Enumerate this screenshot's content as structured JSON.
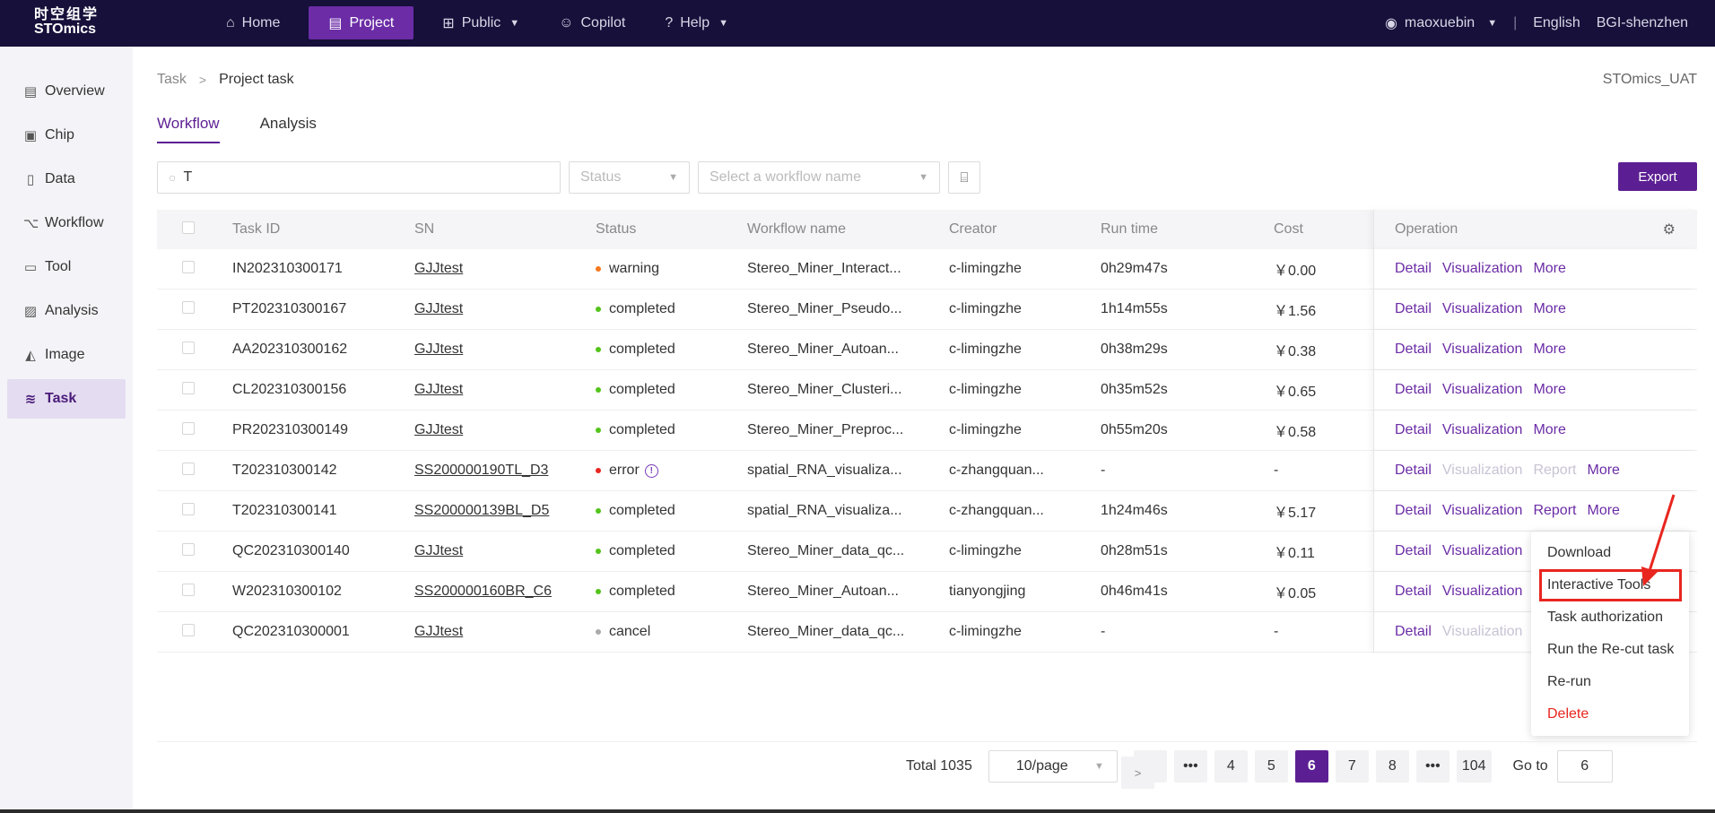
{
  "header": {
    "logo_cn": "时空组学",
    "logo_en": "STOmics",
    "nav": [
      {
        "label": "Home",
        "icon": "home-icon"
      },
      {
        "label": "Project",
        "icon": "document-icon",
        "active": true
      },
      {
        "label": "Public",
        "icon": "grid-icon",
        "dropdown": true
      },
      {
        "label": "Copilot",
        "icon": "copilot-icon"
      },
      {
        "label": "Help",
        "icon": "help-icon",
        "dropdown": true
      }
    ],
    "user": "maoxuebin",
    "separator": "|",
    "language": "English",
    "org": "BGI-shenzhen"
  },
  "sidebar": {
    "items": [
      {
        "label": "Overview",
        "icon": "overview-icon"
      },
      {
        "label": "Chip",
        "icon": "chip-icon"
      },
      {
        "label": "Data",
        "icon": "data-icon"
      },
      {
        "label": "Workflow",
        "icon": "workflow-icon"
      },
      {
        "label": "Tool",
        "icon": "tool-icon"
      },
      {
        "label": "Analysis",
        "icon": "analysis-icon"
      },
      {
        "label": "Image",
        "icon": "image-icon"
      },
      {
        "label": "Task",
        "icon": "layers-icon",
        "active": true
      }
    ]
  },
  "breadcrumb": {
    "parent": "Task",
    "current": "Project task"
  },
  "environment": "STOmics_UAT",
  "tabs": [
    {
      "label": "Workflow",
      "active": true
    },
    {
      "label": "Analysis",
      "active": false
    }
  ],
  "filters": {
    "search_value": "T",
    "status_placeholder": "Status",
    "workflow_placeholder": "Select a workflow name",
    "export_label": "Export"
  },
  "table": {
    "columns": [
      "Task ID",
      "SN",
      "Status",
      "Workflow name",
      "Creator",
      "Run time",
      "Cost",
      "Operation"
    ],
    "rows": [
      {
        "id": "IN202310300171",
        "sn": "GJJtest",
        "status": "warning",
        "status_color": "#f5781f",
        "workflow": "Stereo_Miner_Interact...",
        "creator": "c-limingzhe",
        "run": "0h29m47s",
        "cost": "￥0.00",
        "ops": [
          "Detail",
          "Visualization",
          "More"
        ],
        "disabled": []
      },
      {
        "id": "PT202310300167",
        "sn": "GJJtest",
        "status": "completed",
        "status_color": "#52c41a",
        "workflow": "Stereo_Miner_Pseudo...",
        "creator": "c-limingzhe",
        "run": "1h14m55s",
        "cost": "￥1.56",
        "ops": [
          "Detail",
          "Visualization",
          "More"
        ],
        "disabled": []
      },
      {
        "id": "AA202310300162",
        "sn": "GJJtest",
        "status": "completed",
        "status_color": "#52c41a",
        "workflow": "Stereo_Miner_Autoan...",
        "creator": "c-limingzhe",
        "run": "0h38m29s",
        "cost": "￥0.38",
        "ops": [
          "Detail",
          "Visualization",
          "More"
        ],
        "disabled": []
      },
      {
        "id": "CL202310300156",
        "sn": "GJJtest",
        "status": "completed",
        "status_color": "#52c41a",
        "workflow": "Stereo_Miner_Clusteri...",
        "creator": "c-limingzhe",
        "run": "0h35m52s",
        "cost": "￥0.65",
        "ops": [
          "Detail",
          "Visualization",
          "More"
        ],
        "disabled": []
      },
      {
        "id": "PR202310300149",
        "sn": "GJJtest",
        "status": "completed",
        "status_color": "#52c41a",
        "workflow": "Stereo_Miner_Preproc...",
        "creator": "c-limingzhe",
        "run": "0h55m20s",
        "cost": "￥0.58",
        "ops": [
          "Detail",
          "Visualization",
          "More"
        ],
        "disabled": []
      },
      {
        "id": "T202310300142",
        "sn": "SS200000190TL_D3",
        "status": "error",
        "status_color": "#e8261f",
        "has_info": true,
        "workflow": "spatial_RNA_visualiza...",
        "creator": "c-zhangquan...",
        "run": "-",
        "cost": "-",
        "ops": [
          "Detail",
          "Visualization",
          "Report",
          "More"
        ],
        "disabled": [
          1,
          2
        ]
      },
      {
        "id": "T202310300141",
        "sn": "SS200000139BL_D5",
        "status": "completed",
        "status_color": "#52c41a",
        "workflow": "spatial_RNA_visualiza...",
        "creator": "c-zhangquan...",
        "run": "1h24m46s",
        "cost": "￥5.17",
        "ops": [
          "Detail",
          "Visualization",
          "Report",
          "More"
        ],
        "disabled": []
      },
      {
        "id": "QC202310300140",
        "sn": "GJJtest",
        "status": "completed",
        "status_color": "#52c41a",
        "workflow": "Stereo_Miner_data_qc...",
        "creator": "c-limingzhe",
        "run": "0h28m51s",
        "cost": "￥0.11",
        "ops": [
          "Detail",
          "Visualization"
        ],
        "disabled": []
      },
      {
        "id": "W202310300102",
        "sn": "SS200000160BR_C6",
        "status": "completed",
        "status_color": "#52c41a",
        "workflow": "Stereo_Miner_Autoan...",
        "creator": "tianyongjing",
        "run": "0h46m41s",
        "cost": "￥0.05",
        "ops": [
          "Detail",
          "Visualization"
        ],
        "disabled": []
      },
      {
        "id": "QC202310300001",
        "sn": "GJJtest",
        "status": "cancel",
        "status_color": "#aaaaaa",
        "workflow": "Stereo_Miner_data_qc...",
        "creator": "c-limingzhe",
        "run": "-",
        "cost": "-",
        "ops": [
          "Detail",
          "Visualization"
        ],
        "disabled": [
          1
        ]
      }
    ]
  },
  "more_menu": {
    "items": [
      {
        "label": "Download"
      },
      {
        "label": "Interactive Tools",
        "highlighted": true
      },
      {
        "label": "Task authorization"
      },
      {
        "label": "Run the Re-cut task"
      },
      {
        "label": "Re-run"
      },
      {
        "label": "Delete",
        "danger": true
      }
    ]
  },
  "pagination": {
    "total": "Total 1035",
    "page_size": "10/page",
    "pages": [
      "1",
      "•••",
      "4",
      "5",
      "6",
      "7",
      "8",
      "•••",
      "104"
    ],
    "current": "6",
    "goto_label": "Go to",
    "goto_value": "6"
  },
  "annotation": {
    "arrow_color": "#e8261f",
    "highlight_color": "#e8261f"
  },
  "colors": {
    "brand": "#5c1f93",
    "topbar": "#16103a",
    "link": "#6b2ca6"
  }
}
